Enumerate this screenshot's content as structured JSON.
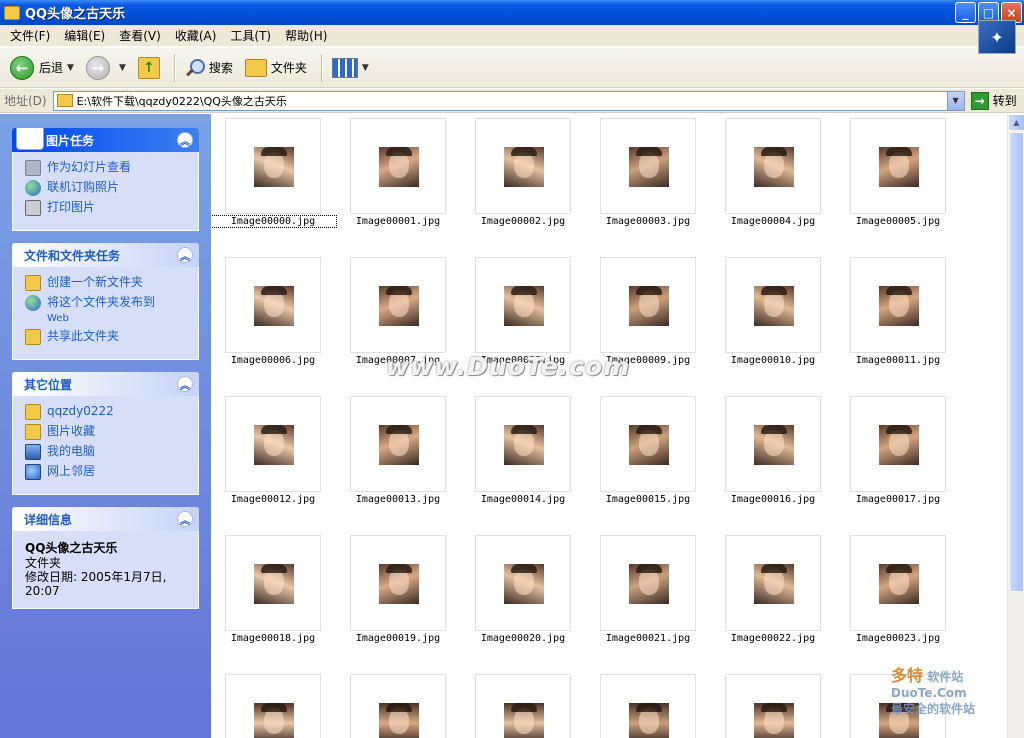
{
  "window": {
    "title": "QQ头像之古天乐",
    "minimize": "_",
    "maximize": "□",
    "close": "×"
  },
  "menu": [
    "文件(F)",
    "编辑(E)",
    "查看(V)",
    "收藏(A)",
    "工具(T)",
    "帮助(H)"
  ],
  "toolbar": {
    "back": "后退",
    "search": "搜索",
    "folders": "文件夹"
  },
  "address": {
    "label": "地址(D)",
    "path": "E:\\软件下载\\qqzdy0222\\QQ头像之古天乐",
    "go": "转到"
  },
  "tasks": {
    "picture": {
      "title": "图片任务",
      "items": [
        "作为幻灯片查看",
        "联机订购照片",
        "打印图片"
      ]
    },
    "file": {
      "title": "文件和文件夹任务",
      "items": [
        "创建一个新文件夹",
        "将这个文件夹发布到",
        "Web",
        "共享此文件夹"
      ]
    },
    "other": {
      "title": "其它位置",
      "items": [
        "qqzdy0222",
        "图片收藏",
        "我的电脑",
        "网上邻居"
      ]
    },
    "details": {
      "title": "详细信息",
      "name": "QQ头像之古天乐",
      "type": "文件夹",
      "modified": "修改日期: 2005年1月7日,",
      "time": "20:07"
    }
  },
  "files": [
    "Image00000.jpg",
    "Image00001.jpg",
    "Image00002.jpg",
    "Image00003.jpg",
    "Image00004.jpg",
    "Image00005.jpg",
    "Image00006.jpg",
    "Image00007.jpg",
    "Image00008.jpg",
    "Image00009.jpg",
    "Image00010.jpg",
    "Image00011.jpg",
    "Image00012.jpg",
    "Image00013.jpg",
    "Image00014.jpg",
    "Image00015.jpg",
    "Image00016.jpg",
    "Image00017.jpg",
    "Image00018.jpg",
    "Image00019.jpg",
    "Image00020.jpg",
    "Image00021.jpg",
    "Image00022.jpg",
    "Image00023.jpg"
  ],
  "watermark": {
    "main": "www.DuoTe.com",
    "brand": "多特",
    "brand_sub": "软件站",
    "brand_url": "DuoTe.Com",
    "slogan": "最安全的软件站"
  },
  "colors": {
    "titlebar": "#0054e3",
    "taskpane": "#6b85dc",
    "link": "#215dc6"
  }
}
